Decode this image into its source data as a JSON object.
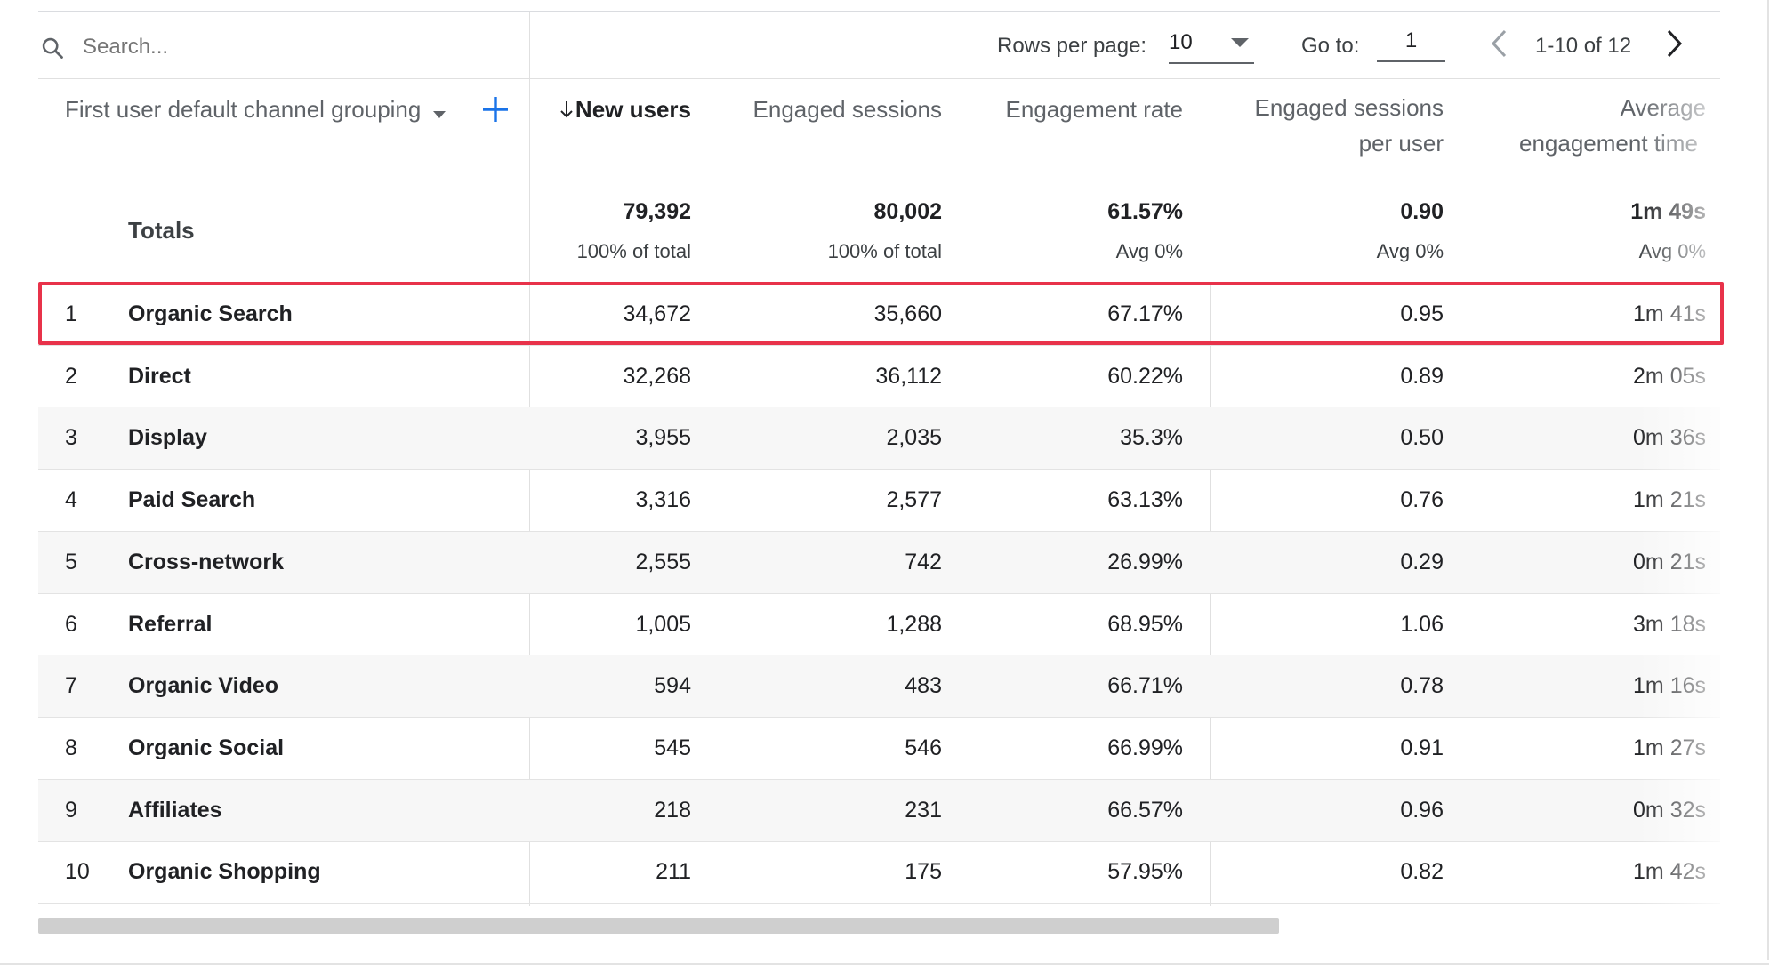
{
  "search": {
    "placeholder": "Search..."
  },
  "pagination": {
    "rows_per_page_label": "Rows per page:",
    "rows_per_page_value": "10",
    "go_to_label": "Go to:",
    "go_to_value": "1",
    "range": "1-10 of 12"
  },
  "columns": {
    "dimension": "First user default channel grouping",
    "new_users": "New users",
    "engaged_sessions": "Engaged sessions",
    "engagement_rate": "Engagement rate",
    "eps_line1": "Engaged sessions",
    "eps_line2": "per user",
    "avg_line1": "Average",
    "avg_line2": "engagement time"
  },
  "totals": {
    "label": "Totals",
    "new_users": "79,392",
    "new_users_sub": "100% of total",
    "engaged_sessions": "80,002",
    "engaged_sessions_sub": "100% of total",
    "engagement_rate": "61.57%",
    "engagement_rate_sub": "Avg 0%",
    "eps": "0.90",
    "eps_sub": "Avg 0%",
    "avg_time": "1m 49s",
    "avg_time_sub": "Avg 0%"
  },
  "rows": [
    {
      "rank": "1",
      "label": "Organic Search",
      "new_users": "34,672",
      "engaged_sessions": "35,660",
      "engagement_rate": "67.17%",
      "eps": "0.95",
      "avg_time": "1m 41s"
    },
    {
      "rank": "2",
      "label": "Direct",
      "new_users": "32,268",
      "engaged_sessions": "36,112",
      "engagement_rate": "60.22%",
      "eps": "0.89",
      "avg_time": "2m 05s"
    },
    {
      "rank": "3",
      "label": "Display",
      "new_users": "3,955",
      "engaged_sessions": "2,035",
      "engagement_rate": "35.3%",
      "eps": "0.50",
      "avg_time": "0m 36s"
    },
    {
      "rank": "4",
      "label": "Paid Search",
      "new_users": "3,316",
      "engaged_sessions": "2,577",
      "engagement_rate": "63.13%",
      "eps": "0.76",
      "avg_time": "1m 21s"
    },
    {
      "rank": "5",
      "label": "Cross-network",
      "new_users": "2,555",
      "engaged_sessions": "742",
      "engagement_rate": "26.99%",
      "eps": "0.29",
      "avg_time": "0m 21s"
    },
    {
      "rank": "6",
      "label": "Referral",
      "new_users": "1,005",
      "engaged_sessions": "1,288",
      "engagement_rate": "68.95%",
      "eps": "1.06",
      "avg_time": "3m 18s"
    },
    {
      "rank": "7",
      "label": "Organic Video",
      "new_users": "594",
      "engaged_sessions": "483",
      "engagement_rate": "66.71%",
      "eps": "0.78",
      "avg_time": "1m 16s"
    },
    {
      "rank": "8",
      "label": "Organic Social",
      "new_users": "545",
      "engaged_sessions": "546",
      "engagement_rate": "66.99%",
      "eps": "0.91",
      "avg_time": "1m 27s"
    },
    {
      "rank": "9",
      "label": "Affiliates",
      "new_users": "218",
      "engaged_sessions": "231",
      "engagement_rate": "66.57%",
      "eps": "0.96",
      "avg_time": "0m 32s"
    },
    {
      "rank": "10",
      "label": "Organic Shopping",
      "new_users": "211",
      "engaged_sessions": "175",
      "engagement_rate": "57.95%",
      "eps": "0.82",
      "avg_time": "1m 42s"
    }
  ],
  "colors": {
    "highlight": "#e8324a",
    "accent": "#1a73e8",
    "row_alt": "#f7f7f7"
  },
  "icons": [
    "search-icon",
    "dropdown-arrow-icon",
    "add-dimension-icon",
    "sort-down-arrow-icon",
    "chevron-left-icon",
    "chevron-right-icon"
  ]
}
